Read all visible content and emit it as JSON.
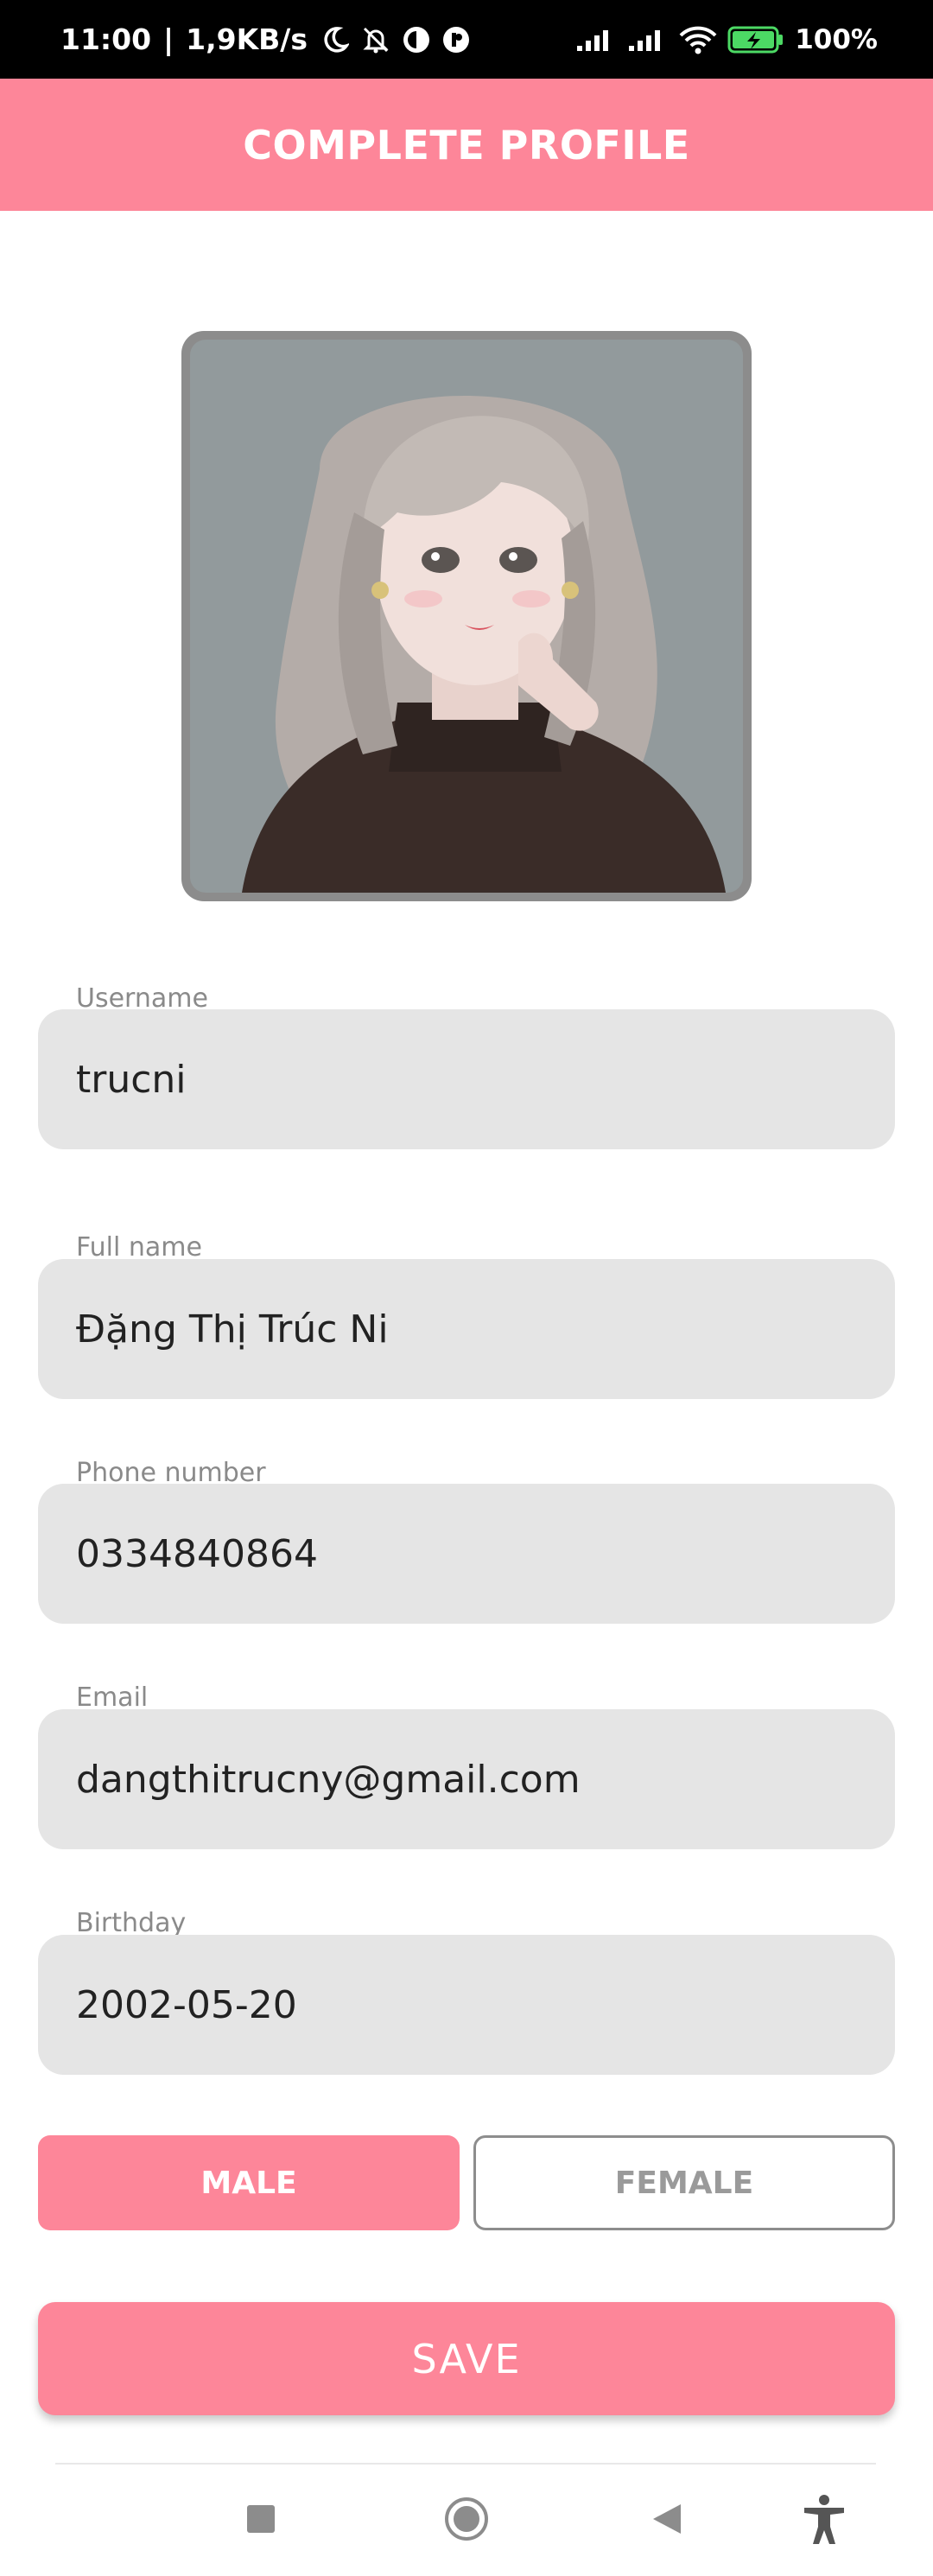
{
  "status_bar": {
    "time": "11:00",
    "separator": "|",
    "speed": "1,9KB/s",
    "battery": "100%",
    "icons": [
      "moon-icon",
      "bell-off-icon",
      "app-icon",
      "app-icon",
      "signal-icon",
      "signal-icon",
      "wifi-icon",
      "battery-charging-icon"
    ]
  },
  "app_bar": {
    "title": "COMPLETE PROFILE"
  },
  "avatar": {
    "icon": "profile-photo"
  },
  "fields": {
    "username": {
      "label": "Username",
      "value": "trucni"
    },
    "fullname": {
      "label": "Full name",
      "value": "Đặng Thị Trúc Ni"
    },
    "phone": {
      "label": "Phone number",
      "value": "0334840864"
    },
    "email": {
      "label": "Email",
      "value": "dangthitrucny@gmail.com"
    },
    "birthday": {
      "label": "Birthday",
      "value": "2002-05-20"
    }
  },
  "gender": {
    "male": "MALE",
    "female": "FEMALE",
    "selected": "MALE"
  },
  "save": {
    "label": "SAVE"
  },
  "colors": {
    "accent": "#fd8699",
    "field_bg": "#e5e5e5",
    "label": "#8a8a8a"
  },
  "nav": {
    "icons": [
      "square-icon",
      "circle-home-icon",
      "triangle-back-icon",
      "accessibility-icon"
    ]
  }
}
